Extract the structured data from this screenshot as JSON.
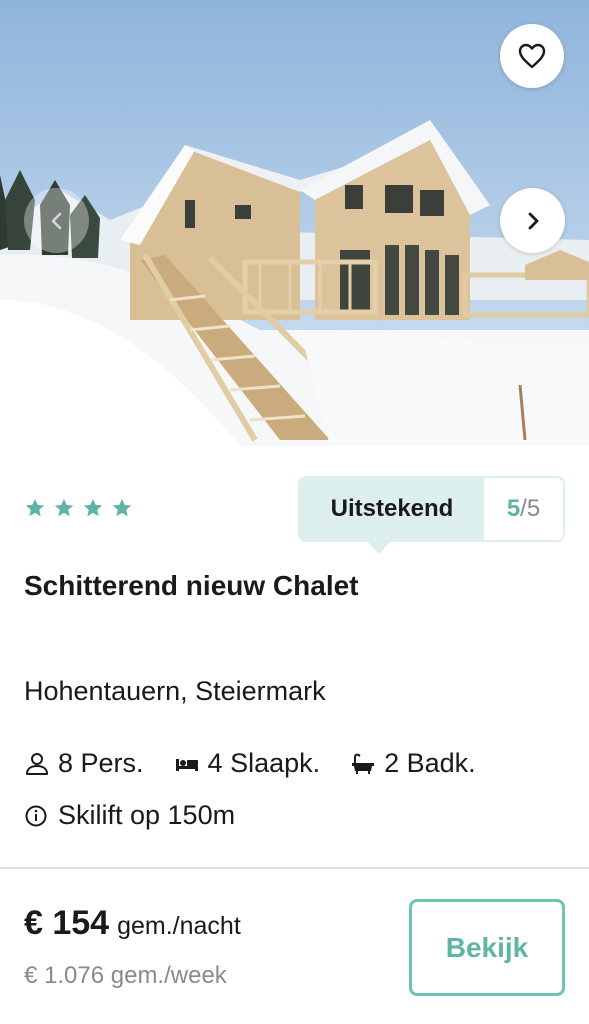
{
  "listing": {
    "photo_alt": "",
    "stars": 4,
    "rating": {
      "label": "Uitstekend",
      "score": "5",
      "max": "/5"
    },
    "title": "Schitterend nieuw Chalet",
    "location": "Hohentauern, Steiermark",
    "features": [
      {
        "icon": "person-icon",
        "label": "8 Pers."
      },
      {
        "icon": "bed-icon",
        "label": "4 Slaapk."
      },
      {
        "icon": "bathtub-icon",
        "label": "2 Badk."
      }
    ],
    "extra": {
      "icon": "info-icon",
      "label": "Skilift op 150m"
    },
    "price": {
      "amount": "€ 154",
      "per_night": "gem./nacht",
      "week": "€ 1.076 gem./week"
    },
    "cta": "Bekijk"
  },
  "colors": {
    "accent": "#5cb5a5",
    "badge_bg": "#dcefed",
    "muted": "#8a8a8a"
  }
}
